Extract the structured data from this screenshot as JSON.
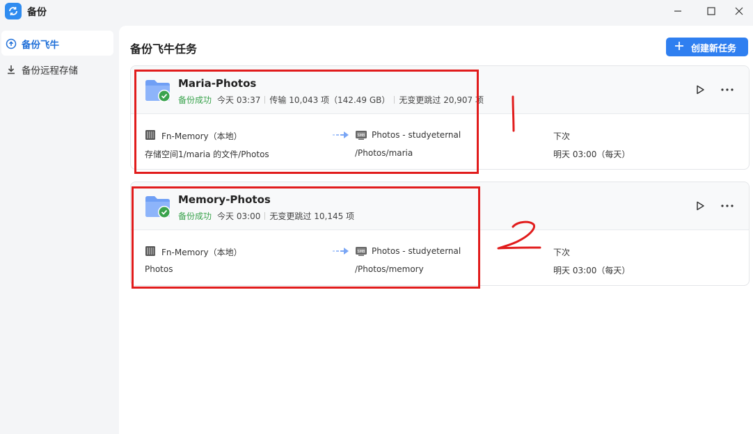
{
  "app": {
    "title": "备份",
    "icon": "sync-backup-icon"
  },
  "window": {
    "buttons": [
      "minimize-icon",
      "maximize-icon",
      "close-icon"
    ]
  },
  "sidebar": {
    "items": [
      {
        "label": "备份飞牛",
        "icon": "cloud-upload-icon",
        "active": true
      },
      {
        "label": "备份远程存储",
        "icon": "download-icon",
        "active": false
      }
    ]
  },
  "main": {
    "title": "备份飞牛任务",
    "create_button": "创建新任务"
  },
  "tasks": [
    {
      "name": "Maria-Photos",
      "status": "备份成功",
      "time": "今天 03:37",
      "transfer": "传输 10,043 项（142.49 GB）",
      "skipped": "无变更跳过 20,907 项",
      "source_label": "Fn-Memory（本地）",
      "source_path": "存储空间1/maria 的文件/Photos",
      "dest_label": "Photos - studyeternal",
      "dest_path": "/Photos/maria",
      "next_label": "下次",
      "next_value": "明天 03:00（每天）"
    },
    {
      "name": "Memory-Photos",
      "status": "备份成功",
      "time": "今天 03:00",
      "skipped": "无变更跳过 10,145 项",
      "source_label": "Fn-Memory（本地）",
      "source_path": "Photos",
      "dest_label": "Photos - studyeternal",
      "dest_path": "/Photos/memory",
      "next_label": "下次",
      "next_value": "明天 03:00（每天）"
    }
  ],
  "colors": {
    "accent": "#2f7ff0",
    "success": "#3aa34d",
    "annotation": "#e11c1c"
  },
  "annotations": [
    "1",
    "2"
  ]
}
